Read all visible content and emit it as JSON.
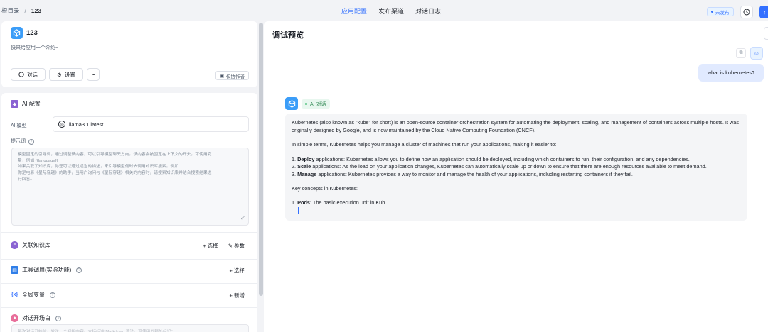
{
  "breadcrumb": {
    "root": "根目录",
    "separator": "/",
    "current": "123"
  },
  "tabs": [
    {
      "label": "应用配置",
      "active": true
    },
    {
      "label": "发布渠道",
      "active": false
    },
    {
      "label": "对话日志",
      "active": false
    }
  ],
  "header": {
    "status_badge": "未发布",
    "history_icon": "clock-icon"
  },
  "app": {
    "name": "123",
    "description": "快来给应用一个介绍~",
    "chat_button": "对话",
    "settings_button": "设置",
    "more_button": "···",
    "author_button": "仅协作者"
  },
  "ai_config": {
    "title": "AI 配置",
    "model_label": "AI 模型",
    "model_value": "llama3.1:latest",
    "prompt_label": "提示词",
    "prompt_placeholder_lines": [
      "模型固定的引导词，通过调整该内容，可以引导模型聊天方向。该内容会被固定在上下文的开头。可使用变",
      "量，例如 {{language}}",
      "如果关联了知识库，你还可以通过适当的描述，来引导模型何时去调用知识库搜索。例如：",
      "你是电影《星际穿越》的助手，当用户询问与《星际穿越》相关的内容时，请搜索知识库并结合搜索结果进",
      "行回答。"
    ]
  },
  "sections": {
    "knowledge": {
      "title": "关联知识库",
      "action_select": "+ 选择",
      "action_params": "参数"
    },
    "tools": {
      "title": "工具调用(实验功能)",
      "action_select": "+ 选择"
    },
    "variables": {
      "title": "全局变量",
      "action_add": "+ 新增"
    },
    "opener": {
      "title": "对话开场白",
      "placeholder": "每次对话开始前，发送一个初始内容。支持标准 Markdown 语法，可使用的额外标记："
    }
  },
  "preview": {
    "title": "调试预览",
    "user_message": "what is kubernetes?",
    "ai_tag": "AI 对话",
    "ai_response": {
      "intro": "Kubernetes (also known as \"kube\" for short) is an open-source container orchestration system for automating the deployment, scaling, and management of containers across multiple hosts. It was originally designed by Google, and is now maintained by the Cloud Native Computing Foundation (CNCF).",
      "simple": "In simple terms, Kubernetes helps you manage a cluster of machines that run your applications, making it easier to:",
      "list": [
        {
          "num": "1.",
          "bold": "Deploy",
          "text": " applications: Kubernetes allows you to define how an application should be deployed, including which containers to run, their configuration, and any dependencies."
        },
        {
          "num": "2.",
          "bold": "Scale",
          "text": " applications: As the load on your application changes, Kubernetes can automatically scale up or down to ensure that there are enough resources available to meet demand."
        },
        {
          "num": "3.",
          "bold": "Manage",
          "text": " applications: Kubernetes provides a way to monitor and manage the health of your applications, including restarting containers if they fail."
        }
      ],
      "concepts_heading": "Key concepts in Kubernetes:",
      "concept_1": {
        "num": "1.",
        "bold": "Pods",
        "text": ": The basic execution unit in Kub"
      }
    }
  },
  "colors": {
    "accent": "#3370ff",
    "app_icon": "#3b9df8",
    "user_bubble": "#e1eaff",
    "ai_bubble": "#f4f5f7"
  }
}
